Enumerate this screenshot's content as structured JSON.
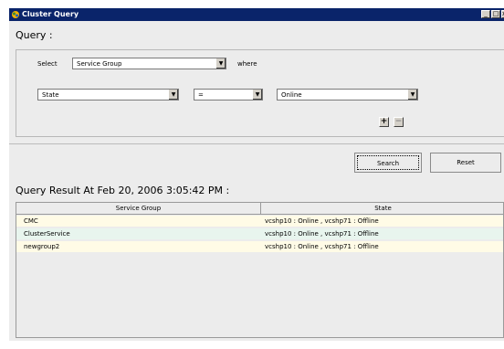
{
  "window": {
    "title": "Cluster Query",
    "controls": {
      "minimize": "_",
      "maximize": "□",
      "close": "x"
    }
  },
  "query": {
    "heading": "Query :",
    "select_label": "Select",
    "select_value": "Service Group",
    "where_label": "where",
    "condition": {
      "attribute": "State",
      "operator": "=",
      "value": "Online"
    },
    "add_symbol": "+",
    "remove_symbol": "−"
  },
  "actions": {
    "search_label": "Search",
    "reset_label": "Reset"
  },
  "results": {
    "heading": "Query Result At Feb 20, 2006 3:05:42 PM :",
    "columns": [
      "Service Group",
      "State"
    ],
    "rows": [
      {
        "group": "CMC",
        "state": "vcshp10 : Online , vcshp71 : Offline"
      },
      {
        "group": "ClusterService",
        "state": "vcshp10 : Online , vcshp71 : Offline"
      },
      {
        "group": "newgroup2",
        "state": "vcshp10 : Online , vcshp71 : Offline"
      }
    ]
  },
  "colors": {
    "titlebar": "#0a246a",
    "row_odd": "#fffbe6",
    "row_even": "#e8f5ee"
  }
}
